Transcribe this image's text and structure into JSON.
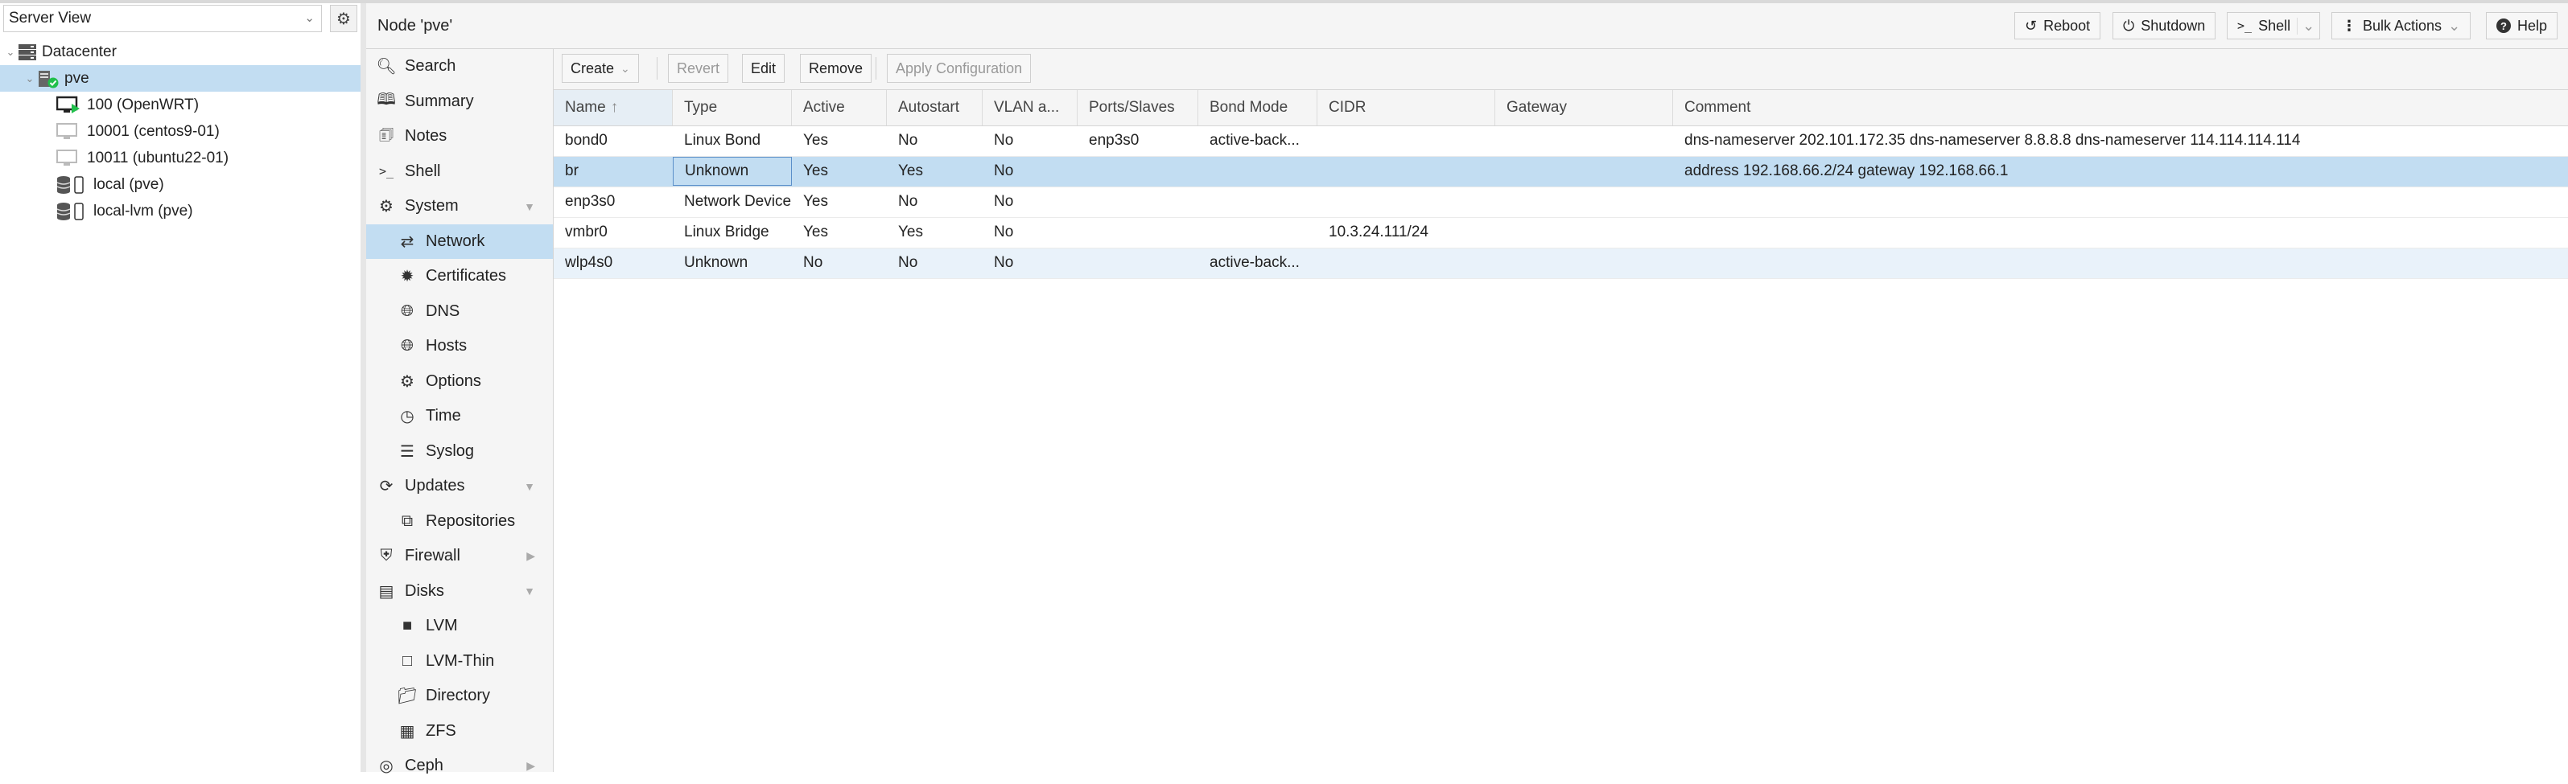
{
  "view_select": {
    "value": "Server View"
  },
  "tree": {
    "datacenter": "Datacenter",
    "node": "pve",
    "vms": [
      {
        "label": "100 (OpenWRT)",
        "status": "running"
      },
      {
        "label": "10001 (centos9-01)",
        "status": "stopped"
      },
      {
        "label": "10011 (ubuntu22-01)",
        "status": "stopped"
      }
    ],
    "storages": [
      {
        "label": "local (pve)"
      },
      {
        "label": "local-lvm (pve)"
      }
    ]
  },
  "header": {
    "title": "Node 'pve'",
    "buttons": {
      "reboot": "Reboot",
      "shutdown": "Shutdown",
      "shell": "Shell",
      "bulk": "Bulk Actions",
      "help": "Help"
    }
  },
  "nav": {
    "search": "Search",
    "summary": "Summary",
    "notes": "Notes",
    "shell": "Shell",
    "system": "System",
    "network": "Network",
    "certificates": "Certificates",
    "dns": "DNS",
    "hosts": "Hosts",
    "options": "Options",
    "time": "Time",
    "syslog": "Syslog",
    "updates": "Updates",
    "repositories": "Repositories",
    "firewall": "Firewall",
    "disks": "Disks",
    "lvm": "LVM",
    "lvm_thin": "LVM-Thin",
    "directory": "Directory",
    "zfs": "ZFS",
    "ceph": "Ceph"
  },
  "toolbar": {
    "create": "Create",
    "revert": "Revert",
    "edit": "Edit",
    "remove": "Remove",
    "apply": "Apply Configuration"
  },
  "grid": {
    "columns": [
      "Name",
      "Type",
      "Active",
      "Autostart",
      "VLAN a...",
      "Ports/Slaves",
      "Bond Mode",
      "CIDR",
      "Gateway",
      "Comment"
    ],
    "rows": [
      {
        "name": "bond0",
        "type": "Linux Bond",
        "active": "Yes",
        "autostart": "No",
        "vlan": "No",
        "ports": "enp3s0",
        "bond_mode": "active-back...",
        "cidr": "",
        "gateway": "",
        "comment": "dns-nameserver 202.101.172.35 dns-nameserver 8.8.8.8 dns-nameserver 114.114.114.114"
      },
      {
        "name": "br",
        "type": "Unknown",
        "active": "Yes",
        "autostart": "Yes",
        "vlan": "No",
        "ports": "",
        "bond_mode": "",
        "cidr": "",
        "gateway": "",
        "comment": "address 192.168.66.2/24 gateway 192.168.66.1"
      },
      {
        "name": "enp3s0",
        "type": "Network Device",
        "active": "Yes",
        "autostart": "No",
        "vlan": "No",
        "ports": "",
        "bond_mode": "",
        "cidr": "",
        "gateway": "",
        "comment": ""
      },
      {
        "name": "vmbr0",
        "type": "Linux Bridge",
        "active": "Yes",
        "autostart": "Yes",
        "vlan": "No",
        "ports": "",
        "bond_mode": "",
        "cidr": "10.3.24.111/24",
        "gateway": "",
        "comment": ""
      },
      {
        "name": "wlp4s0",
        "type": "Unknown",
        "active": "No",
        "autostart": "No",
        "vlan": "No",
        "ports": "",
        "bond_mode": "active-back...",
        "cidr": "",
        "gateway": "",
        "comment": ""
      }
    ]
  },
  "colors": {
    "selected": "#c2ddf2",
    "accent": "#3892d4",
    "running": "#21bf4b"
  }
}
